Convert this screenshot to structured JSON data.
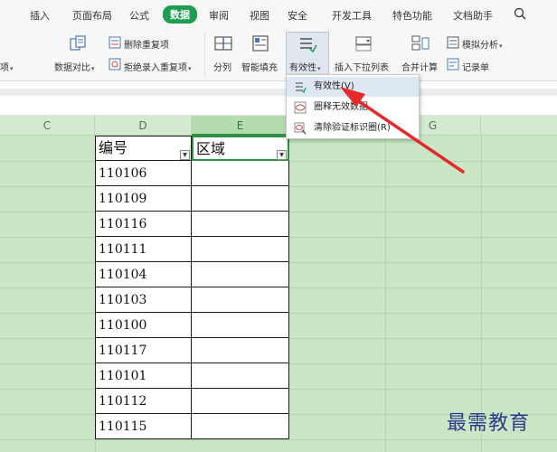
{
  "menu_tabs": [
    "插入",
    "页面布局",
    "公式",
    "数据",
    "审阅",
    "视图",
    "安全",
    "开发工具",
    "特色功能",
    "文档助手"
  ],
  "active_tab": "数据",
  "ribbon": {
    "delete_dup": "删除重复项",
    "reject_dup": "拒绝录入重复项",
    "left_cut": "项",
    "compare": "数据对比",
    "split": "分列",
    "smart_fill": "智能填充",
    "validity": "有效性",
    "insert_dropdown": "插入下拉列表",
    "merge_calc": "合并计算",
    "simulate": "模拟分析",
    "record_form": "记录单"
  },
  "columns": {
    "c": "C",
    "d": "D",
    "e": "E",
    "g": "G"
  },
  "header": {
    "number": "编号",
    "region": "区域"
  },
  "rows": [
    "110106",
    "110109",
    "110116",
    "110111",
    "110104",
    "110103",
    "110100",
    "110117",
    "110101",
    "110112",
    "110115"
  ],
  "dropdown": {
    "item1": "有效性(V)",
    "item2": "圈释无效数据",
    "item3": "清除验证标识圈(R)"
  },
  "watermark": "最需教育",
  "colors": {
    "active_tab": "#1e9e52",
    "sheet_bg": "#c9e7c5",
    "arrow": "#e5282b",
    "watermark": "#2e3a8c"
  }
}
